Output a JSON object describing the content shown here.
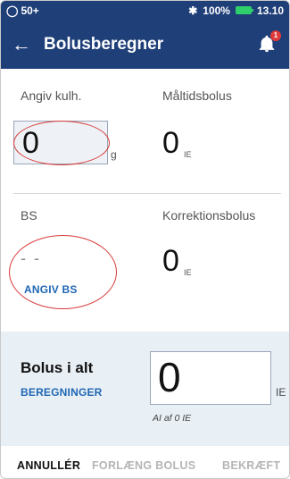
{
  "status": {
    "left": "50+",
    "battery": "100%",
    "time": "13.10"
  },
  "appbar": {
    "title": "Bolusberegner",
    "notification_count": "1"
  },
  "carbs": {
    "label": "Angiv kulh.",
    "value": "0",
    "unit": "g"
  },
  "meal_bolus": {
    "label": "Måltidsbolus",
    "value": "0",
    "unit": "IE"
  },
  "bg": {
    "label": "BS",
    "value": "- -",
    "enter_label": "ANGIV BS"
  },
  "correction_bolus": {
    "label": "Korrektionsbolus",
    "value": "0",
    "unit": "IE"
  },
  "total": {
    "label": "Bolus i alt",
    "calc_link": "BEREGNINGER",
    "value": "0",
    "unit": "IE",
    "note": "AI af 0 IE"
  },
  "footer": {
    "cancel": "ANNULLÉR",
    "extend": "FORLÆNG BOLUS",
    "confirm": "BEKRÆFT"
  },
  "colors": {
    "primary": "#1f3f78",
    "link": "#1f66b4",
    "panel": "#e9f0f5",
    "highlight": "#d83b3b"
  }
}
